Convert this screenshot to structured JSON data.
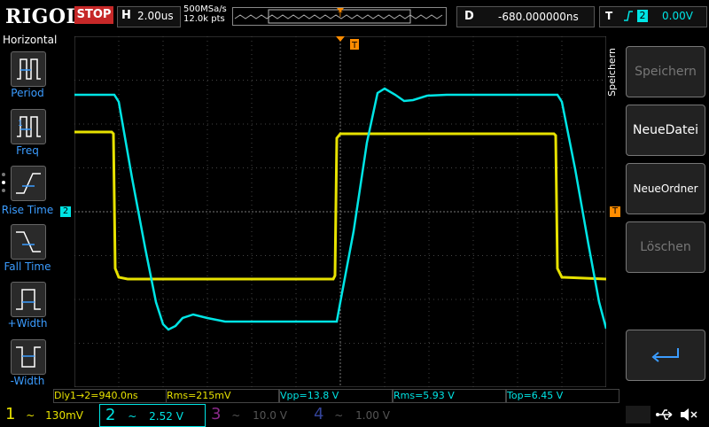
{
  "brand": "RIGOL",
  "run_state": "STOP",
  "timebase": {
    "label": "H",
    "value": "2.00us"
  },
  "sample": {
    "rate": "500MSa/s",
    "points": "12.0k pts"
  },
  "delay": {
    "label": "D",
    "value": "-680.000000ns"
  },
  "trigger": {
    "label": "T",
    "edge_icon": "rising-edge-icon",
    "source": "2",
    "level": "0.00V"
  },
  "left_menu": {
    "title": "Horizontal",
    "items": [
      {
        "label": "Period"
      },
      {
        "label": "Freq"
      },
      {
        "label": "Rise Time"
      },
      {
        "label": "Fall Time"
      },
      {
        "label": "+Width"
      },
      {
        "label": "-Width"
      }
    ]
  },
  "right_menu": {
    "title": "Speichern",
    "buttons": [
      {
        "label": "Speichern",
        "enabled": false
      },
      {
        "label": "NeueDatei",
        "enabled": true
      },
      {
        "label": "NeueOrdner",
        "enabled": true
      },
      {
        "label": "Löschen",
        "enabled": false
      }
    ],
    "enter_icon": "enter-icon"
  },
  "measurements": [
    {
      "text": "Dly1→2=940.0ns",
      "channel": 1
    },
    {
      "text": "Rms=215mV",
      "channel": 1
    },
    {
      "text": "Vpp=13.8 V",
      "channel": 2
    },
    {
      "text": "Rms=5.93 V",
      "channel": 2
    },
    {
      "text": "Top=6.45 V",
      "channel": 2
    }
  ],
  "channels": [
    {
      "num": "1",
      "coupling": "~",
      "scale": "130mV",
      "color": "#e7e200",
      "active": true
    },
    {
      "num": "2",
      "coupling": "~",
      "scale": "2.52 V",
      "color": "#00e5e5",
      "active": true
    },
    {
      "num": "3",
      "coupling": "~",
      "scale": "10.0 V",
      "color": "#c020c0",
      "active": false
    },
    {
      "num": "4",
      "coupling": "~",
      "scale": "1.00 V",
      "color": "#3050ff",
      "active": false
    }
  ],
  "markers": {
    "ch2": "2",
    "trigger_pos": "T"
  },
  "colors": {
    "ch1": "#e7e200",
    "ch2": "#00e5e5",
    "trigger": "#ff8c00",
    "grid": "#3a3a3a",
    "menu_accent": "#3b9cff",
    "stop": "#c62828"
  },
  "status_icons": [
    "usb-icon",
    "speaker-muted-icon"
  ]
}
